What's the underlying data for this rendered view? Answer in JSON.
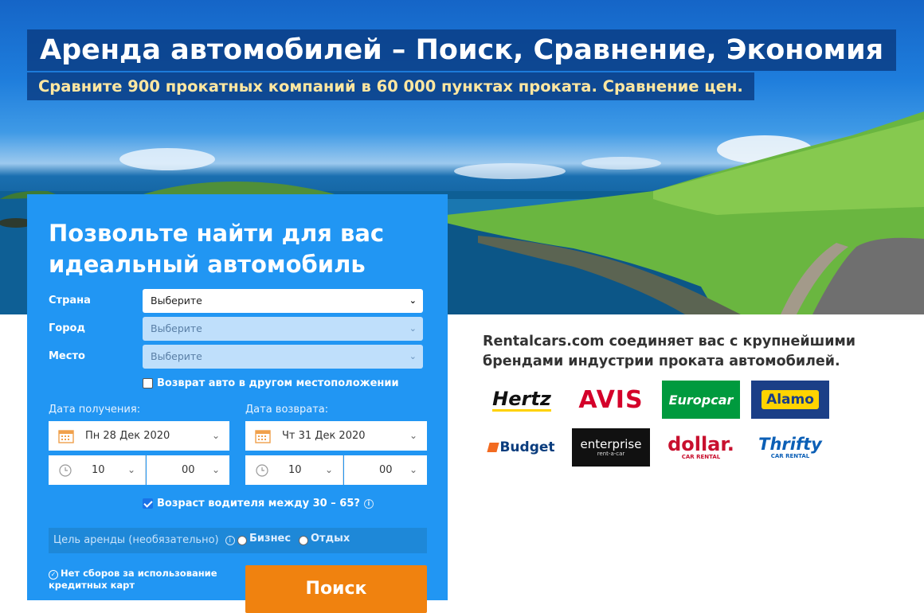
{
  "hero": {
    "title": "Аренда автомобилей – Поиск, Сравнение, Экономия",
    "subtitle": "Сравните 900 прокатных компаний в 60 000 пунктах проката. Сравнение цен."
  },
  "search_form": {
    "heading": "Позвольте найти для вас идеальный автомобиль",
    "country_label": "Страна",
    "country_value": "Выберите",
    "city_label": "Город",
    "city_value": "Выберите",
    "location_label": "Место",
    "location_value": "Выберите",
    "return_other_label": "Возврат авто в другом местоположении",
    "return_other_checked": false,
    "pickup_label": "Дата получения:",
    "pickup_date": "Пн 28 Дек 2020",
    "pickup_hour": "10",
    "pickup_minute": "00",
    "dropoff_label": "Дата возврата:",
    "dropoff_date": "Чт 31 Дек 2020",
    "dropoff_hour": "10",
    "dropoff_minute": "00",
    "driver_age_label": "Возраст водителя между 30 – 65?",
    "driver_age_checked": true,
    "purpose_label": "Цель аренды (необязательно)",
    "purpose_business": "Бизнес",
    "purpose_leisure": "Отдых",
    "no_fees_text": "Нет сборов за использование кредитных карт",
    "search_button": "Поиск"
  },
  "brands": {
    "description": "Rentalcars.com соединяет вас с крупнейшими брендами индустрии проката автомобилей.",
    "logos": [
      "Hertz",
      "AVIS",
      "Europcar",
      "Alamo",
      "Budget",
      "enterprise",
      "dollar.",
      "Thrifty"
    ],
    "dollar_sub": "CAR RENTAL",
    "thrifty_sub": "CAR RENTAL",
    "enterprise_sub": "rent-a-car"
  },
  "colors": {
    "form_bg": "#2196f3",
    "search_button": "#f0820f",
    "title_band": "#0a3c82",
    "subtitle_text": "#ffe7a1"
  }
}
